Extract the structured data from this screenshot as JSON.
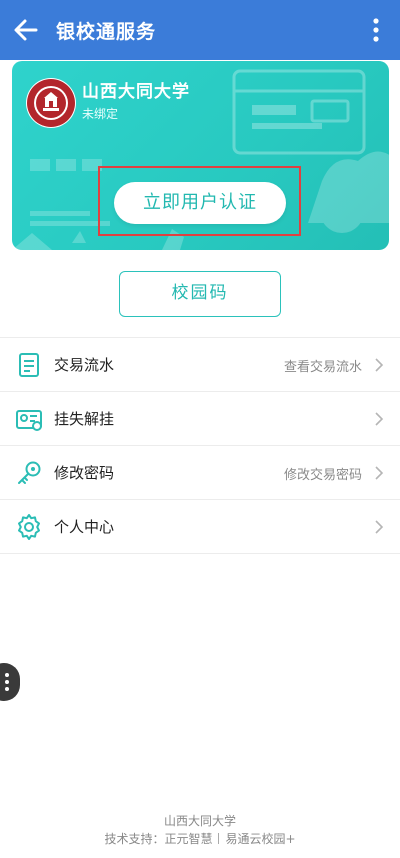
{
  "header": {
    "title": "银校通服务",
    "back_icon": "arrow-left-icon",
    "more_icon": "more-vertical-icon",
    "bg_color": "#3b7cd9"
  },
  "card": {
    "school_name": "山西大同大学",
    "bind_status": "未绑定",
    "verify_button": "立即用户认证",
    "accent_color": "#2fd3cc"
  },
  "campus_code_button": "校园码",
  "menu": [
    {
      "label": "交易流水",
      "hint": "查看交易流水",
      "icon": "receipt-icon"
    },
    {
      "label": "挂失解挂",
      "hint": "",
      "icon": "id-card-icon"
    },
    {
      "label": "修改密码",
      "hint": "修改交易密码",
      "icon": "key-icon"
    },
    {
      "label": "个人中心",
      "hint": "",
      "icon": "gear-icon"
    }
  ],
  "footer": {
    "line1": "山西大同大学",
    "support_label": "技术支持：正元智慧",
    "partner": "易通云校园+"
  }
}
